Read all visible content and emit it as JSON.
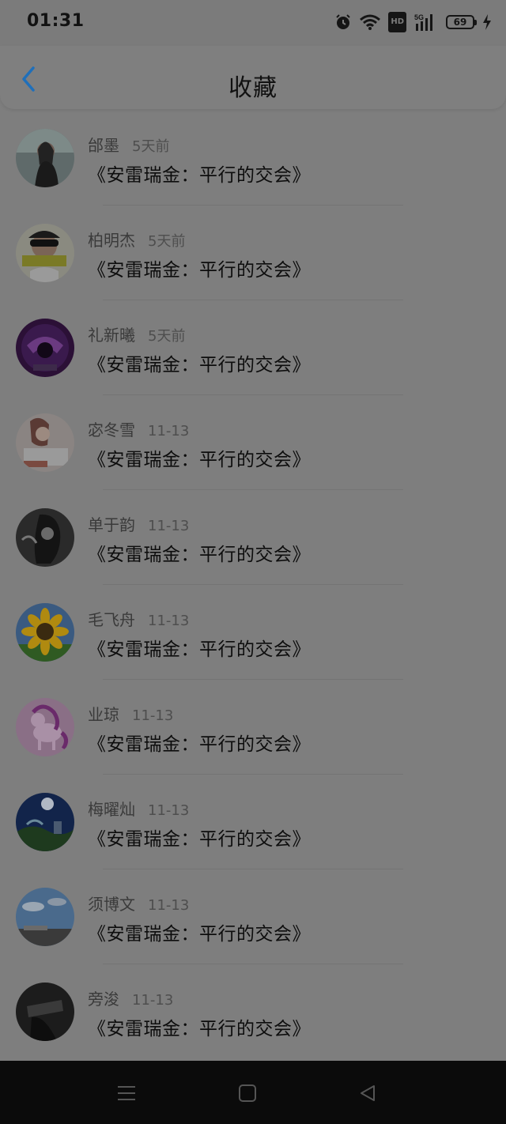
{
  "status_bar": {
    "time": "01:31",
    "icons": [
      "alarm-icon",
      "wifi-icon",
      "hd-icon",
      "5g-signal-icon",
      "battery-icon",
      "charging-icon"
    ],
    "hd_label": "HD",
    "network_label": "5G",
    "battery_level": "69"
  },
  "header": {
    "title": "收藏",
    "back_icon": "chevron-left-icon",
    "accent_color": "#1f7fd4"
  },
  "items": [
    {
      "name": "邰墨",
      "time": "5天前",
      "title": "《安雷瑞金：平行的交会》"
    },
    {
      "name": "柏明杰",
      "time": "5天前",
      "title": "《安雷瑞金：平行的交会》"
    },
    {
      "name": "礼新曦",
      "time": "5天前",
      "title": "《安雷瑞金：平行的交会》"
    },
    {
      "name": "宓冬雪",
      "time": "11-13",
      "title": "《安雷瑞金：平行的交会》"
    },
    {
      "name": "单于韵",
      "time": "11-13",
      "title": "《安雷瑞金：平行的交会》"
    },
    {
      "name": "毛飞舟",
      "time": "11-13",
      "title": "《安雷瑞金：平行的交会》"
    },
    {
      "name": "业琼",
      "time": "11-13",
      "title": "《安雷瑞金：平行的交会》"
    },
    {
      "name": "梅曜灿",
      "time": "11-13",
      "title": "《安雷瑞金：平行的交会》"
    },
    {
      "name": "须博文",
      "time": "11-13",
      "title": "《安雷瑞金：平行的交会》"
    },
    {
      "name": "旁浚",
      "time": "11-13",
      "title": "《安雷瑞金：平行的交会》"
    }
  ],
  "system_nav": {
    "buttons": [
      "menu-icon",
      "home-icon",
      "back-triangle-icon"
    ]
  }
}
